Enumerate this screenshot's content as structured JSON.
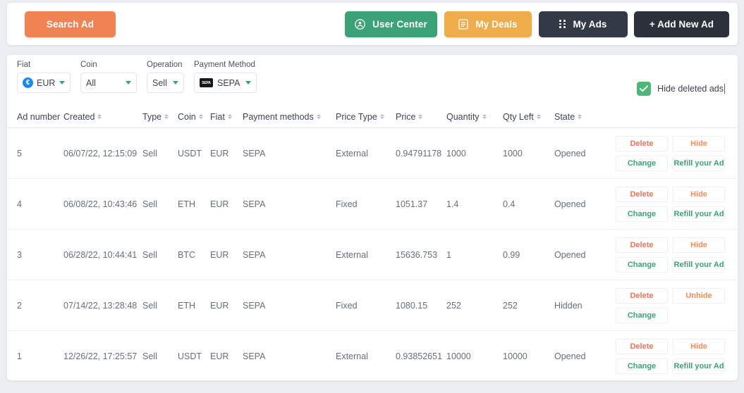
{
  "topbar": {
    "search_label": "Search Ad",
    "user_center_label": "User Center",
    "my_deals_label": "My Deals",
    "my_ads_label": "My Ads",
    "add_new_ad_label": "+ Add New Ad",
    "colors": {
      "search": "#ef8354",
      "user_center": "#3aa276",
      "my_deals": "#eeac4a",
      "my_ads": "#333a45",
      "add_new_ad": "#2b303a"
    }
  },
  "filters": {
    "fiat": {
      "label": "Fiat",
      "value": "EUR",
      "icon": "euro-coin-icon"
    },
    "coin": {
      "label": "Coin",
      "value": "All"
    },
    "operation": {
      "label": "Operation",
      "value": "Sell"
    },
    "payment_method": {
      "label": "Payment Method",
      "value": "SEPA",
      "icon": "sepa-icon"
    }
  },
  "hide_deleted": {
    "label": "Hide deleted ads",
    "checked": true,
    "check_color": "#4cb878"
  },
  "table": {
    "columns": [
      {
        "key": "ad_number",
        "label": "Ad number",
        "sortable": false
      },
      {
        "key": "created",
        "label": "Created",
        "sortable": true
      },
      {
        "key": "type",
        "label": "Type",
        "sortable": true
      },
      {
        "key": "coin",
        "label": "Coin",
        "sortable": true
      },
      {
        "key": "fiat",
        "label": "Fiat",
        "sortable": true
      },
      {
        "key": "payment_methods",
        "label": "Payment methods",
        "sortable": true
      },
      {
        "key": "price_type",
        "label": "Price Type",
        "sortable": true
      },
      {
        "key": "price",
        "label": "Price",
        "sortable": true
      },
      {
        "key": "quantity",
        "label": "Quantity",
        "sortable": true
      },
      {
        "key": "qty_left",
        "label": "Qty Left",
        "sortable": true
      },
      {
        "key": "state",
        "label": "State",
        "sortable": true
      }
    ],
    "rows": [
      {
        "ad_number": "5",
        "created": "06/07/22, 12:15:09",
        "type": "Sell",
        "coin": "USDT",
        "fiat": "EUR",
        "payment_methods": "SEPA",
        "price_type": "External",
        "price": "0.94791178",
        "quantity": "1000",
        "qty_left": "1000",
        "state": "Opened",
        "actions": [
          "Delete",
          "Hide",
          "Change",
          "Refill your Ad"
        ]
      },
      {
        "ad_number": "4",
        "created": "06/08/22, 10:43:46",
        "type": "Sell",
        "coin": "ETH",
        "fiat": "EUR",
        "payment_methods": "SEPA",
        "price_type": "Fixed",
        "price": "1051.37",
        "quantity": "1.4",
        "qty_left": "0.4",
        "state": "Opened",
        "actions": [
          "Delete",
          "Hide",
          "Change",
          "Refill your Ad"
        ]
      },
      {
        "ad_number": "3",
        "created": "06/28/22, 10:44:41",
        "type": "Sell",
        "coin": "BTC",
        "fiat": "EUR",
        "payment_methods": "SEPA",
        "price_type": "External",
        "price": "15636.753",
        "quantity": "1",
        "qty_left": "0.99",
        "state": "Opened",
        "actions": [
          "Delete",
          "Hide",
          "Change",
          "Refill your Ad"
        ]
      },
      {
        "ad_number": "2",
        "created": "07/14/22, 13:28:48",
        "type": "Sell",
        "coin": "ETH",
        "fiat": "EUR",
        "payment_methods": "SEPA",
        "price_type": "Fixed",
        "price": "1080.15",
        "quantity": "252",
        "qty_left": "252",
        "state": "Hidden",
        "actions": [
          "Delete",
          "Unhide",
          "Change",
          ""
        ]
      },
      {
        "ad_number": "1",
        "created": "12/26/22, 17:25:57",
        "type": "Sell",
        "coin": "USDT",
        "fiat": "EUR",
        "payment_methods": "SEPA",
        "price_type": "External",
        "price": "0.93852651",
        "quantity": "10000",
        "qty_left": "10000",
        "state": "Opened",
        "actions": [
          "Delete",
          "Hide",
          "Change",
          "Refill your Ad"
        ]
      }
    ]
  }
}
